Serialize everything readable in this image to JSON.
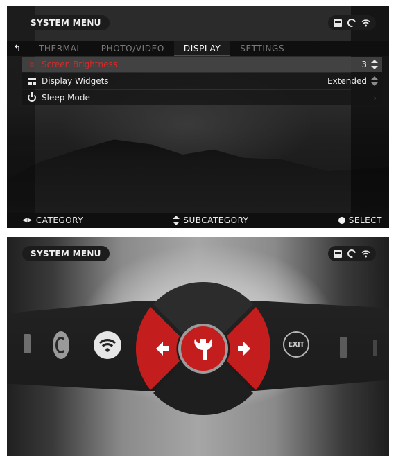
{
  "panel1": {
    "title": "SYSTEM MENU",
    "tabs": [
      {
        "label": "THERMAL",
        "active": false
      },
      {
        "label": "PHOTO/VIDEO",
        "active": false
      },
      {
        "label": "DISPLAY",
        "active": true
      },
      {
        "label": "SETTINGS",
        "active": false
      }
    ],
    "rows": [
      {
        "label": "Screen Brightness",
        "value": "3",
        "icon": "sun-icon",
        "selected": true
      },
      {
        "label": "Display Widgets",
        "value": "Extended",
        "icon": "widget-icon",
        "selected": false
      },
      {
        "label": "Sleep Mode",
        "value": "",
        "icon": "power-icon",
        "selected": false
      }
    ],
    "bottom": {
      "category": "CATEGORY",
      "subcategory": "SUBCATEGORY",
      "select": "SELECT"
    }
  },
  "panel2": {
    "title": "SYSTEM MENU",
    "exit_label": "EXIT",
    "carousel": [
      "battery-icon",
      "compass-icon",
      "wifi-icon",
      "system-wheel",
      "exit-icon",
      "brush-icon",
      "flag-icon"
    ]
  },
  "colors": {
    "accent": "#c41d1d",
    "highlight_text": "#d82a2a",
    "background": "#121212"
  }
}
